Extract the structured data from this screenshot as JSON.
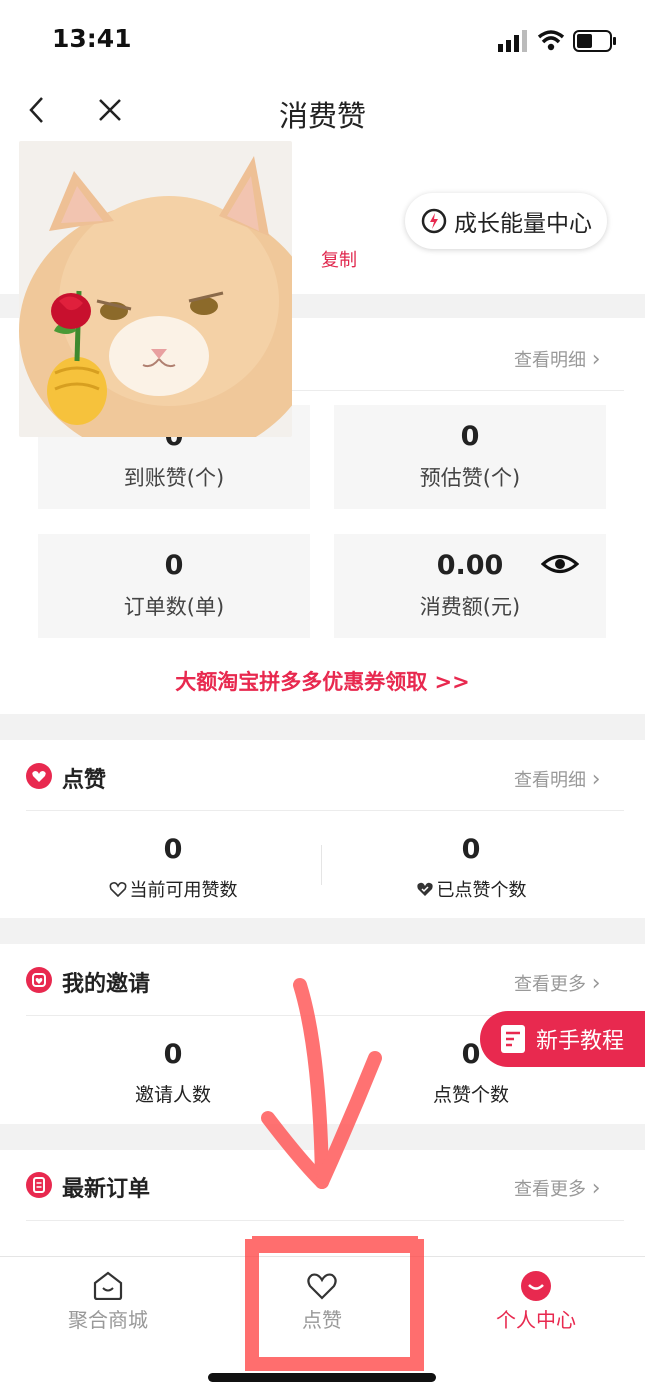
{
  "status": {
    "time": "13:41"
  },
  "nav": {
    "title": "消费赞"
  },
  "header": {
    "growth_center": "成长能量中心",
    "copy": "复制"
  },
  "consume": {
    "view_detail": "查看明细",
    "stats": [
      {
        "value": "0",
        "label": "到账赞(个)"
      },
      {
        "value": "0",
        "label": "预估赞(个)"
      },
      {
        "value": "0",
        "label": "订单数(单)"
      },
      {
        "value": "0.00",
        "label": "消费额(元)"
      }
    ],
    "coupon_link": "大额淘宝拼多多优惠券领取 >>"
  },
  "likes": {
    "title": "点赞",
    "view_detail": "查看明细",
    "stats": [
      {
        "value": "0",
        "label": "当前可用赞数"
      },
      {
        "value": "0",
        "label": "已点赞个数"
      }
    ]
  },
  "invite": {
    "title": "我的邀请",
    "view_more": "查看更多",
    "stats": [
      {
        "value": "0",
        "label": "邀请人数"
      },
      {
        "value": "0",
        "label": "点赞个数"
      }
    ]
  },
  "orders": {
    "title": "最新订单",
    "view_more": "查看更多"
  },
  "tutorial": {
    "label": "新手教程"
  },
  "tabbar": {
    "items": [
      {
        "label": "聚合商城",
        "icon": "home-icon",
        "active": false
      },
      {
        "label": "点赞",
        "icon": "heart-icon",
        "active": false
      },
      {
        "label": "个人中心",
        "icon": "smile-icon",
        "active": true
      }
    ]
  },
  "colors": {
    "accent": "#e8294f",
    "annotation": "#ff5a5a"
  }
}
